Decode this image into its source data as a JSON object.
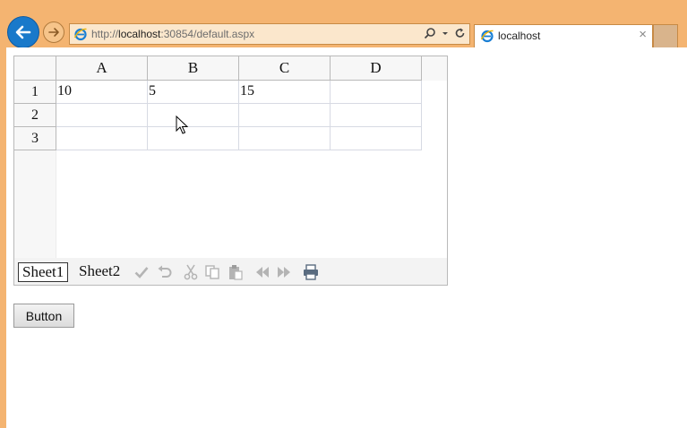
{
  "browser": {
    "url_prefix": "http://",
    "url_host": "localhost",
    "url_rest": ":30854/default.aspx",
    "tab_title": "localhost",
    "tab_close": "×",
    "icons": [
      "back-arrow-icon",
      "forward-arrow-icon",
      "ie-logo-icon",
      "search-icon",
      "dropdown-icon",
      "refresh-icon"
    ]
  },
  "spreadsheet": {
    "columns": [
      "A",
      "B",
      "C",
      "D"
    ],
    "rows": [
      "1",
      "2",
      "3"
    ],
    "cells": [
      [
        "10",
        "5",
        "15",
        ""
      ],
      [
        "",
        "",
        "",
        ""
      ],
      [
        "",
        "",
        "",
        ""
      ]
    ],
    "sheet_tabs": [
      "Sheet1",
      "Sheet2"
    ],
    "active_sheet": "Sheet1",
    "toolbar_icons": [
      "check-icon",
      "undo-icon",
      "cut-icon",
      "copy-icon",
      "paste-icon",
      "previous-sheet-icon",
      "next-sheet-icon",
      "print-icon"
    ]
  },
  "button": {
    "label": "Button"
  }
}
